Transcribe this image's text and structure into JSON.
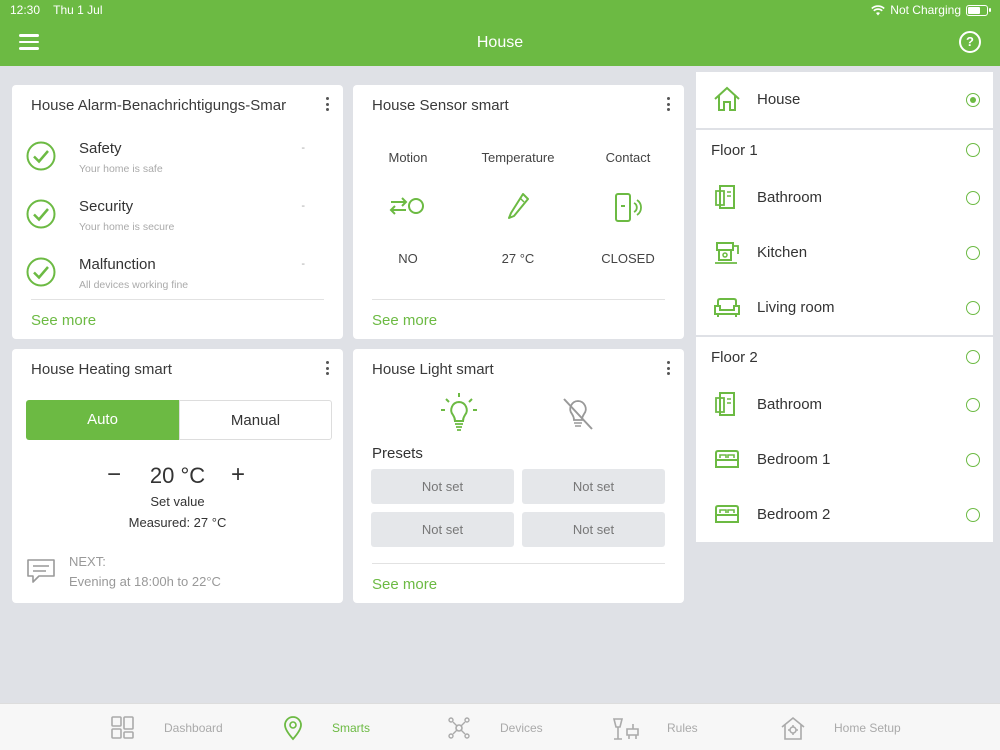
{
  "status": {
    "time": "12:30",
    "date": "Thu 1 Jul",
    "battery_text": "Not Charging",
    "battery_level": 0.7
  },
  "header": {
    "title": "House",
    "help_label": "?"
  },
  "colors": {
    "accent": "#6cba43",
    "background": "#dfe1e6"
  },
  "alarm": {
    "title": "House Alarm-Benachrichtigungs-Smar",
    "items": [
      {
        "name": "Safety",
        "sub": "Your home is safe",
        "value": "-",
        "icon": "check-circle-icon"
      },
      {
        "name": "Security",
        "sub": "Your home is secure",
        "value": "-",
        "icon": "check-circle-icon"
      },
      {
        "name": "Malfunction",
        "sub": "All devices working fine",
        "value": "-",
        "icon": "check-circle-icon"
      }
    ],
    "see_more": "See more"
  },
  "sensor": {
    "title": "House Sensor smart",
    "columns": [
      {
        "label": "Motion",
        "value": "NO",
        "icon": "motion-icon"
      },
      {
        "label": "Temperature",
        "value": "27 °C",
        "icon": "thermometer-icon"
      },
      {
        "label": "Contact",
        "value": "CLOSED",
        "icon": "door-contact-icon"
      }
    ],
    "see_more": "See more"
  },
  "heating": {
    "title": "House Heating smart",
    "mode_auto": "Auto",
    "mode_manual": "Manual",
    "minus": "−",
    "plus": "+",
    "setpoint": "20 °C",
    "setpoint_label": "Set value",
    "measured": "Measured:  27 °C",
    "next_label": "NEXT:",
    "next_text": "Evening at 18:00h to 22°C"
  },
  "light": {
    "title": "House Light smart",
    "presets_label": "Presets",
    "presets": [
      "Not set",
      "Not set",
      "Not set",
      "Not set"
    ],
    "see_more": "See more"
  },
  "rooms": {
    "house": {
      "name": "House",
      "selected": true,
      "icon": "house-icon"
    },
    "floors": [
      {
        "name": "Floor 1",
        "rooms": [
          {
            "name": "Bathroom",
            "icon": "bathroom-icon"
          },
          {
            "name": "Kitchen",
            "icon": "kitchen-icon"
          },
          {
            "name": "Living room",
            "icon": "sofa-icon"
          }
        ]
      },
      {
        "name": "Floor 2",
        "rooms": [
          {
            "name": "Bathroom",
            "icon": "bathroom-icon"
          },
          {
            "name": "Bedroom 1",
            "icon": "bed-icon"
          },
          {
            "name": "Bedroom 2",
            "icon": "bed-icon"
          }
        ]
      }
    ]
  },
  "nav": [
    {
      "label": "Dashboard",
      "icon": "dashboard-icon",
      "active": false
    },
    {
      "label": "Smarts",
      "icon": "smarts-icon",
      "active": true
    },
    {
      "label": "Devices",
      "icon": "devices-icon",
      "active": false
    },
    {
      "label": "Rules",
      "icon": "rules-icon",
      "active": false
    },
    {
      "label": "Home Setup",
      "icon": "home-setup-icon",
      "active": false
    }
  ]
}
